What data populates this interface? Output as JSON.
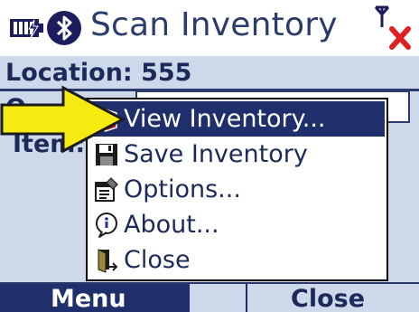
{
  "title_bar": {
    "title": "Scan Inventory",
    "icons": [
      "battery-icon",
      "bluetooth-icon",
      "no-signal-icon"
    ]
  },
  "form": {
    "location_label": "Location: 555",
    "row2_label": "O",
    "item_label": "Item:"
  },
  "menu": {
    "items": [
      {
        "label": "View Inventory...",
        "icon": "book-icon",
        "selected": true
      },
      {
        "label": "Save Inventory",
        "icon": "floppy-disk-icon",
        "selected": false
      },
      {
        "label": "Options...",
        "icon": "options-icon",
        "selected": false
      },
      {
        "label": "About...",
        "icon": "info-bubble-icon",
        "selected": false
      },
      {
        "label": "Close",
        "icon": "exit-door-icon",
        "selected": false
      }
    ]
  },
  "softkeys": {
    "left_label": "Menu",
    "right_label": "Close"
  },
  "colors": {
    "accent": "#1f2f6b",
    "background": "#cdd8ea",
    "arrow": "#f5ea12",
    "close_x": "#e02020"
  }
}
